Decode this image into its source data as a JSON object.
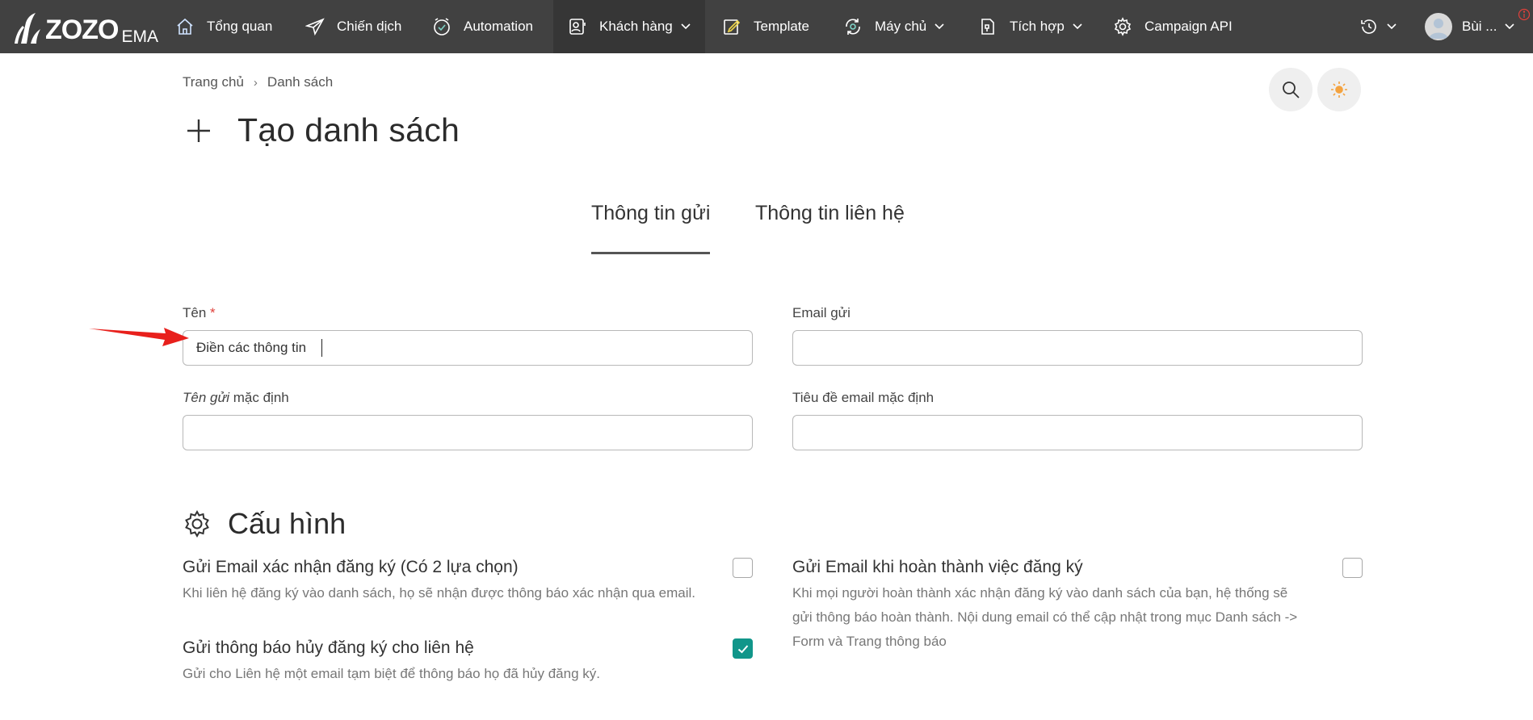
{
  "brand": {
    "name": "ZOZO",
    "suffix": "EMA"
  },
  "nav": {
    "items": [
      {
        "label": "Tổng quan",
        "icon": "home-icon",
        "dropdown": false
      },
      {
        "label": "Chiến dịch",
        "icon": "send-icon",
        "dropdown": false
      },
      {
        "label": "Automation",
        "icon": "clock-check-icon",
        "dropdown": false
      },
      {
        "label": "Khách hàng",
        "icon": "contacts-icon",
        "dropdown": true
      },
      {
        "label": "Template",
        "icon": "edit-icon",
        "dropdown": false
      },
      {
        "label": "Máy chủ",
        "icon": "server-icon",
        "dropdown": true
      },
      {
        "label": "Tích hợp",
        "icon": "integration-icon",
        "dropdown": true
      },
      {
        "label": "Campaign API",
        "icon": "gear-icon",
        "dropdown": false
      }
    ],
    "active_index": 3,
    "user_name": "Bùi ..."
  },
  "breadcrumb": {
    "home": "Trang chủ",
    "current": "Danh sách"
  },
  "page_title": "Tạo danh sách",
  "tabs": [
    {
      "label": "Thông tin gửi",
      "active": true
    },
    {
      "label": "Thông tin liên hệ",
      "active": false
    }
  ],
  "form": {
    "name_label": "Tên",
    "name_required_mark": "*",
    "name_value": "Điền các thông tin",
    "from_email_label": "Email gửi",
    "from_email_value": "",
    "default_from_name_label_italic": "Tên gửi",
    "default_from_name_label_rest": " mặc định",
    "default_from_name_value": "",
    "default_subject_label": "Tiêu đề email mặc định",
    "default_subject_value": ""
  },
  "config": {
    "title": "Cấu hình",
    "options": [
      {
        "title": "Gửi Email xác nhận đăng ký (Có 2 lựa chọn)",
        "desc": "Khi liên hệ đăng ký vào danh sách, họ sẽ nhận được thông báo xác nhận qua email.",
        "checked": false
      },
      {
        "title": "Gửi thông báo hủy đăng ký cho liên hệ",
        "desc": "Gửi cho Liên hệ một email tạm biệt để thông báo họ đã hủy đăng ký.",
        "checked": true
      },
      {
        "title": "Gửi Email khi hoàn thành việc đăng ký",
        "desc_lines": [
          "Khi mọi người hoàn thành xác nhận đăng ký vào danh sách của bạn, hệ thống sẽ",
          "gửi thông báo hoàn thành. Nội dung email có thể cập nhật trong mục Danh sách ->",
          "Form và Trang thông báo"
        ],
        "checked": false
      }
    ]
  },
  "colors": {
    "navbar": "#414141",
    "checkbox_checked": "#11968a",
    "required": "#e0413b",
    "arrow": "#e8201c",
    "theme_sun": "#f4a340"
  }
}
